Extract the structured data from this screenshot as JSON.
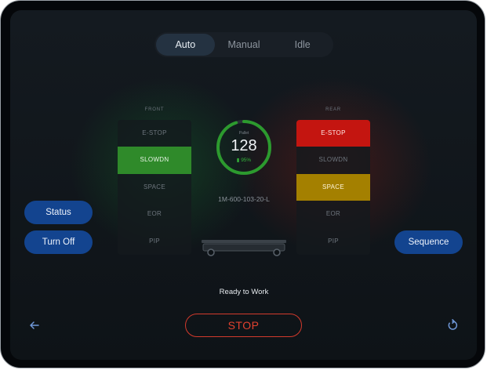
{
  "modes": [
    {
      "label": "Auto",
      "active": true
    },
    {
      "label": "Manual",
      "active": false
    },
    {
      "label": "Idle",
      "active": false
    }
  ],
  "front": {
    "label": "FRONT",
    "zones": [
      "E-STOP",
      "SLOWDN",
      "SPACE",
      "EOR",
      "PIP"
    ],
    "active_zone": "SLOWDN",
    "active_color": "#2f8a2a"
  },
  "rear": {
    "label": "REAR",
    "zones": [
      "E-STOP",
      "SLOWDN",
      "SPACE",
      "EOR",
      "PIP"
    ],
    "highlight": {
      "E-STOP": "#c41510",
      "SPACE": "#a48000"
    }
  },
  "gauge": {
    "label": "Pallet",
    "value": "128",
    "battery_text": "95%",
    "battery_level": 0.95,
    "ring_color": "#2c9a2e"
  },
  "vehicle": {
    "id": "1M-600-103-20-L",
    "icon": "shuttle-vehicle-icon"
  },
  "buttons": {
    "status": "Status",
    "turn_off": "Turn Off",
    "sequence": "Sequence",
    "stop": "STOP"
  },
  "status_text": "Ready to Work",
  "icons": {
    "back": "arrow-left-icon",
    "refresh": "refresh-icon"
  }
}
